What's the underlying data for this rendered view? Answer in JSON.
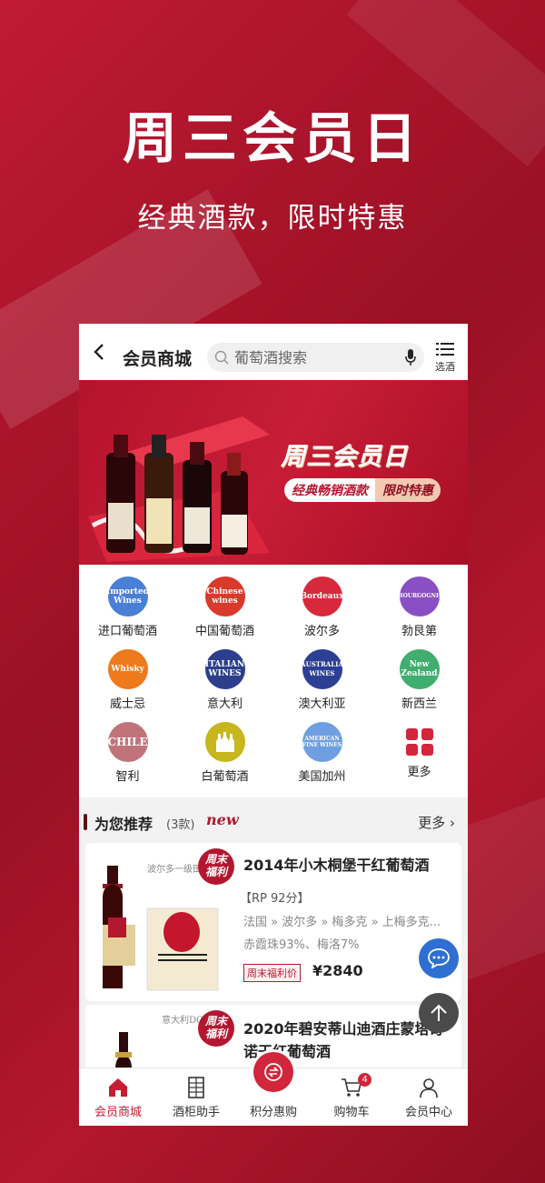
{
  "promo": {
    "title": "周三会员日",
    "subtitle": "经典酒款，限时特惠"
  },
  "header": {
    "title": "会员商城",
    "search_placeholder": "葡萄酒搜索",
    "filter_label": "选酒"
  },
  "banner": {
    "title": "周三会员日",
    "sub_left": "经典畅销酒款",
    "sub_right": "限时特惠"
  },
  "categories": [
    {
      "label": "进口葡萄酒",
      "badge": "Imported Wines",
      "color": "#4a7fd6"
    },
    {
      "label": "中国葡萄酒",
      "badge": "Chinese wines",
      "color": "#d93a2b"
    },
    {
      "label": "波尔多",
      "badge": "Bordeaux",
      "color": "#d8283b"
    },
    {
      "label": "勃艮第",
      "badge": "BOURGOGNE",
      "color": "#8a4fc4"
    },
    {
      "label": "威士忌",
      "badge": "Whisky",
      "color": "#ee7a1b"
    },
    {
      "label": "意大利",
      "badge": "ITALIAN WINES",
      "color": "#2d3f8c"
    },
    {
      "label": "澳大利亚",
      "badge": "AUSTRALIA WINES",
      "color": "#2c3f95"
    },
    {
      "label": "新西兰",
      "badge": "New Zealand",
      "color": "#3fae6f"
    },
    {
      "label": "智利",
      "badge": "CHILE",
      "color": "#c0747a"
    },
    {
      "label": "白葡萄酒",
      "badge": "",
      "color": "#c7b61c"
    },
    {
      "label": "美国加州",
      "badge": "AMERICAN FINE WINES",
      "color": "#6f9fe0"
    },
    {
      "label": "更多",
      "badge": "",
      "color": "#d1263b"
    }
  ],
  "recommend": {
    "title": "为您推荐",
    "count": "(3款)",
    "new_tag": "new",
    "more_label": "更多"
  },
  "products": [
    {
      "name": "2014年小木桐堡干红葡萄酒",
      "tag": "周末\n福利",
      "thumb_text": "波尔多一级田",
      "label_text": "LE PETIT MOUTON DE MOUTON ROTHSCHILD",
      "vintage": "2014",
      "score": "【RP 92分】",
      "origin": "法国 » 波尔多 » 梅多克 » 上梅多克...",
      "grape": "赤霞珠93%、梅洛7%",
      "price_label": "周末福利价",
      "price": "¥2840"
    },
    {
      "name": "2020年碧安蒂山迪酒庄蒙塔奇诺干红葡萄酒",
      "tag": "周末\n福利",
      "thumb_text": "意大利DO"
    }
  ],
  "tabbar": [
    {
      "label": "会员商城",
      "icon": "home-icon",
      "active": true
    },
    {
      "label": "酒柜助手",
      "icon": "wine-cabinet-icon",
      "active": false
    },
    {
      "label": "积分惠购",
      "icon": "points-icon",
      "active": false
    },
    {
      "label": "购物车",
      "icon": "cart-icon",
      "active": false,
      "badge": "4"
    },
    {
      "label": "会员中心",
      "icon": "user-icon",
      "active": false
    }
  ],
  "colors": {
    "brand": "#b3172f",
    "accent": "#d1263b",
    "chat": "#2f6fd1"
  }
}
